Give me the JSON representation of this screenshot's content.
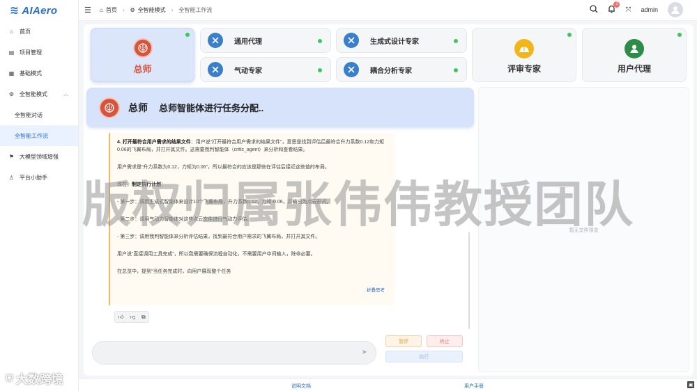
{
  "app": {
    "logo_text": "AIAero"
  },
  "sidebar": {
    "items": [
      {
        "label": "首页",
        "icon": "home-icon"
      },
      {
        "label": "项目管理",
        "icon": "clipboard-icon"
      },
      {
        "label": "基础模式",
        "icon": "grid-icon"
      },
      {
        "label": "全智能模式",
        "icon": "gear-icon"
      },
      {
        "label": "全智能对话"
      },
      {
        "label": "全智能工作流"
      },
      {
        "label": "大模型领域增强",
        "icon": "flag-icon"
      },
      {
        "label": "平台小助手",
        "icon": "user-icon"
      }
    ]
  },
  "header": {
    "breadcrumb": [
      "首页",
      "全智能模式",
      "全智能工作流"
    ],
    "notification_count": "2",
    "username": "admin"
  },
  "agents": {
    "zongshi": "总师",
    "tongyong": "通用代理",
    "shengcheng": "生成式设计专家",
    "qidong": "气动专家",
    "ouhe": "耦合分析专家",
    "pingshen": "评审专家",
    "yonghu": "用户代理"
  },
  "banner": {
    "title": "总师",
    "subtitle": "总师智能体进行任务分配.."
  },
  "message": {
    "p1_bold": "4. 打开最符合用户需求的结果文件",
    "p1": "：用户说“打开最符合用户需求的结果文件”，意思是找到评估后最符合升力系数0.12和力矩0.06的飞翼布局，并打开其文件。这需要我判智能体（critic_agent）来分析和查看结果。",
    "p2": "用户需求是“升力系数为0.12，力矩为0.06”，所以最符合的应该是那些在评估后接近这些值的布局。",
    "p3_prefix": "现在，",
    "p3_bold": "制定执行计划",
    "p3_suffix": "：",
    "p4": "- 第一步：调用生成式智能体来设计10个飞翼布局，升力系数0.12，力矩-0.06，并输出为点云形式。",
    "p5": "- 第二步：调用气动力智能体对这些点云文件进行气动力评估。",
    "p6": "- 第三步：调用我判智能体来分析评估结果，找到最符合用户需求的飞翼布局，并打开其文件。",
    "p7": "用户说“直接调用工具完成”，所以我需要确保流程自动化，不需要用户中间输入，除非必要。",
    "p8": "在总览中，提到“当任务完成时，向用户展现整个任务",
    "collapse": "折叠思考"
  },
  "controls": {
    "pause": "暂停",
    "stop": "终止",
    "execute": "执行"
  },
  "preview": {
    "empty_text": "暂无文件预览"
  },
  "footer": {
    "docs": "说明文档",
    "manual": "用户手册"
  },
  "watermarks": {
    "main": "版权归属张伟伟教授团队",
    "bottom": "大数跨境"
  }
}
